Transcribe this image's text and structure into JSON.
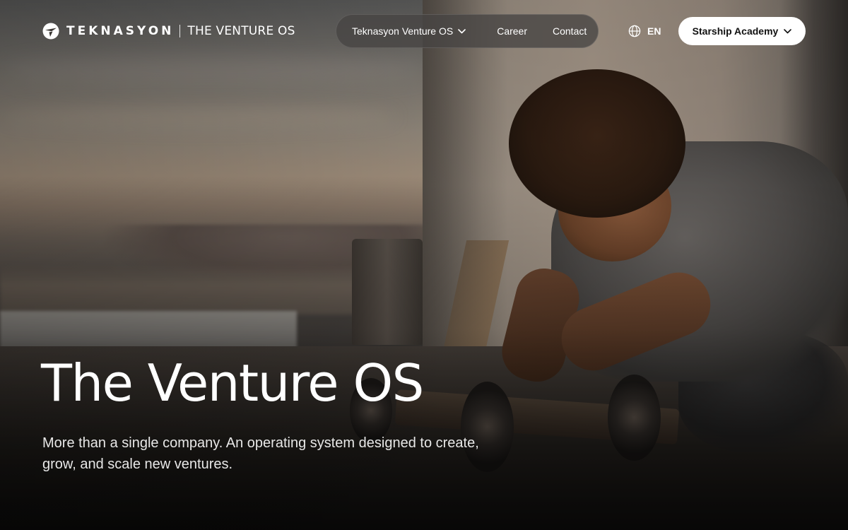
{
  "brand": {
    "name": "TEKNASYON",
    "tagline": "THE VENTURE OS",
    "logo_icon": "teknasyon-logo-icon"
  },
  "nav": {
    "items": [
      {
        "label": "Teknasyon Venture OS",
        "has_dropdown": true
      },
      {
        "label": "Career",
        "has_dropdown": false
      },
      {
        "label": "Contact",
        "has_dropdown": false
      }
    ]
  },
  "language": {
    "icon": "globe-icon",
    "label": "EN"
  },
  "cta": {
    "label": "Starship Academy",
    "has_dropdown": true
  },
  "hero": {
    "title": "The Venture OS",
    "subtitle": "More than a single company. An operating system designed to create, grow, and scale new ventures."
  },
  "colors": {
    "nav_pill_bg": "#464442",
    "cta_bg": "#ffffff",
    "cta_text": "#111111",
    "text": "#ffffff"
  }
}
